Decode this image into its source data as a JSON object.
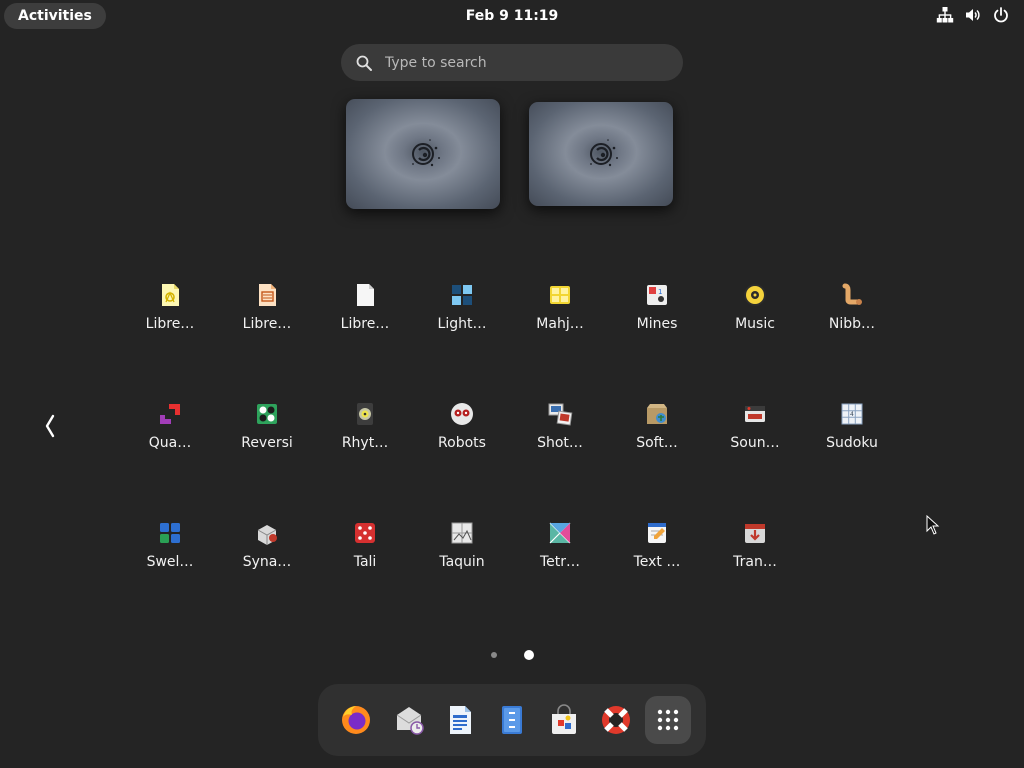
{
  "topbar": {
    "activities_label": "Activities",
    "clock": "Feb 9  11:19",
    "tray_icons": [
      "network-icon",
      "volume-icon",
      "power-icon"
    ]
  },
  "search": {
    "placeholder": "Type to search"
  },
  "workspaces": [
    {
      "name": "workspace-1"
    },
    {
      "name": "workspace-2"
    }
  ],
  "apps": [
    {
      "label": "Libre…",
      "icon": "libreoffice-draw-icon"
    },
    {
      "label": "Libre…",
      "icon": "libreoffice-impress-icon"
    },
    {
      "label": "Libre…",
      "icon": "libreoffice-icon"
    },
    {
      "label": "Light…",
      "icon": "lightsoff-icon"
    },
    {
      "label": "Mahj…",
      "icon": "mahjongg-icon"
    },
    {
      "label": "Mines",
      "icon": "mines-icon"
    },
    {
      "label": "Music",
      "icon": "music-icon"
    },
    {
      "label": "Nibb…",
      "icon": "nibbles-icon"
    },
    {
      "label": "Qua…",
      "icon": "quadrapassel-icon"
    },
    {
      "label": "Reversi",
      "icon": "reversi-icon"
    },
    {
      "label": "Rhyt…",
      "icon": "rhythmbox-icon"
    },
    {
      "label": "Robots",
      "icon": "robots-icon"
    },
    {
      "label": "Shot…",
      "icon": "shotwell-icon"
    },
    {
      "label": "Soft…",
      "icon": "software-icon"
    },
    {
      "label": "Soun…",
      "icon": "sound-recorder-icon"
    },
    {
      "label": "Sudoku",
      "icon": "sudoku-icon"
    },
    {
      "label": "Swel…",
      "icon": "swell-foop-icon"
    },
    {
      "label": "Syna…",
      "icon": "synaptic-icon"
    },
    {
      "label": "Tali",
      "icon": "tali-icon"
    },
    {
      "label": "Taquin",
      "icon": "taquin-icon"
    },
    {
      "label": "Tetr…",
      "icon": "tetravex-icon"
    },
    {
      "label": "Text …",
      "icon": "text-editor-icon"
    },
    {
      "label": "Tran…",
      "icon": "transmission-icon"
    }
  ],
  "pagination": {
    "pages": 2,
    "current": 2
  },
  "dock": [
    {
      "icon": "firefox-icon"
    },
    {
      "icon": "evolution-icon"
    },
    {
      "icon": "libreoffice-writer-icon"
    },
    {
      "icon": "files-icon"
    },
    {
      "icon": "software-center-icon"
    },
    {
      "icon": "help-icon"
    },
    {
      "icon": "show-apps-icon",
      "active": true
    }
  ],
  "colors": {
    "background": "#242424",
    "panel": "#303030",
    "pill": "#3d3d3d",
    "accent": "#ffffff"
  }
}
